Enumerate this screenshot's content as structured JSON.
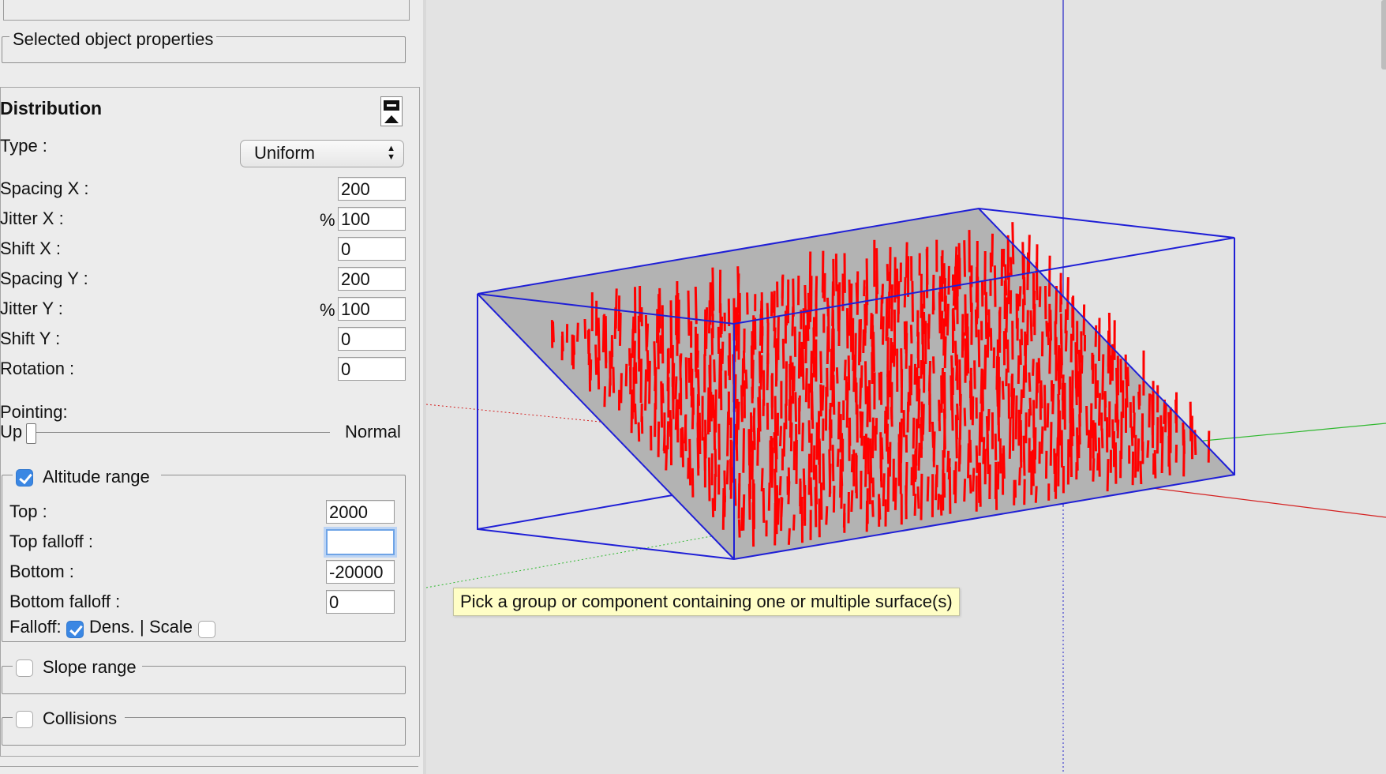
{
  "selected_object": {
    "legend": "Selected object properties"
  },
  "distribution": {
    "title": "Distribution",
    "type_label": "Type :",
    "type_value": "Uniform",
    "spacing_x_label": "Spacing X :",
    "spacing_x": "200",
    "jitter_x_label": "Jitter X :",
    "jitter_x_unit": "%",
    "jitter_x": "100",
    "shift_x_label": "Shift X :",
    "shift_x": "0",
    "spacing_y_label": "Spacing Y :",
    "spacing_y": "200",
    "jitter_y_label": "Jitter Y :",
    "jitter_y_unit": "%",
    "jitter_y": "100",
    "shift_y_label": "Shift Y :",
    "shift_y": "0",
    "rotation_label": "Rotation :",
    "rotation": "0",
    "pointing_label": "Pointing:",
    "pointing_min": "Up",
    "pointing_max": "Normal",
    "pointing_level": 0
  },
  "altitude": {
    "legend": "Altitude range",
    "checked": true,
    "top_label": "Top :",
    "top": "2000",
    "top_falloff_label": "Top falloff :",
    "top_falloff": "",
    "bottom_label": "Bottom :",
    "bottom": "-20000",
    "bottom_falloff_label": "Bottom falloff :",
    "bottom_falloff": "0",
    "falloff_label": "Falloff:",
    "dens_label": "Dens.",
    "separator": "|",
    "scale_label": "Scale",
    "dens_checked": true,
    "scale_checked": false
  },
  "slope": {
    "legend": "Slope range",
    "checked": false
  },
  "collisions": {
    "legend": "Collisions",
    "checked": false
  },
  "tooltip": "Pick a group or component containing one or multiple surface(s)",
  "colors": {
    "bounding_box": "#1f1fd6",
    "surface": "#b3b3b3",
    "instances": "#ff0000",
    "axis_red": "#d42020",
    "axis_green": "#2fb82f",
    "axis_blue": "#2323c8"
  },
  "icons": [
    "collapse-icon",
    "select-arrows-icon",
    "checkmark-icon"
  ]
}
